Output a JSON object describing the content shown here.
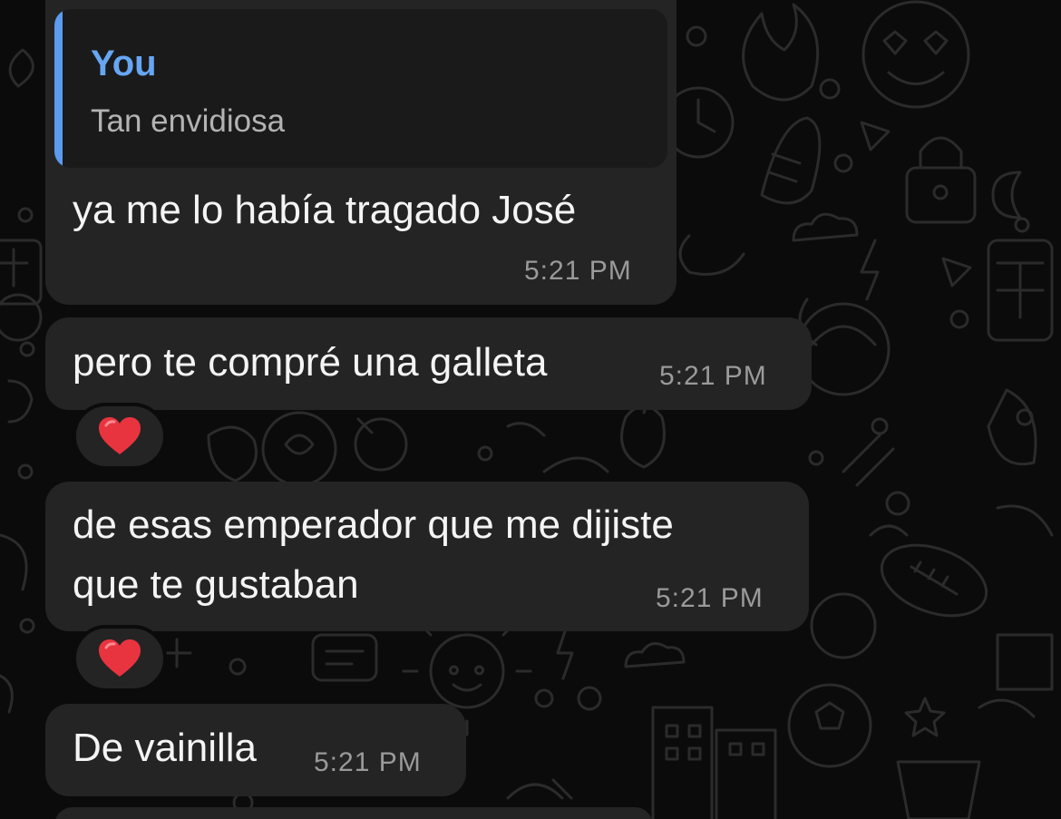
{
  "quoted_reply": {
    "author": "You",
    "text": "Tan envidiosa"
  },
  "messages": [
    {
      "lines": [
        "ya me lo había tragado José"
      ],
      "time": "5:21 PM"
    },
    {
      "lines": [
        "pero te compré una galleta"
      ],
      "time": "5:21 PM",
      "reaction": "heart"
    },
    {
      "lines": [
        "de esas emperador que me dijiste",
        "que te gustaban"
      ],
      "time": "5:21 PM",
      "reaction": "heart"
    },
    {
      "lines": [
        "De vainilla"
      ],
      "time": "5:21 PM"
    }
  ],
  "colors": {
    "background": "#0b0b0b",
    "bubble": "#242424",
    "quote_accent": "#5b9bf0",
    "reaction_heart": "#e8343f"
  }
}
